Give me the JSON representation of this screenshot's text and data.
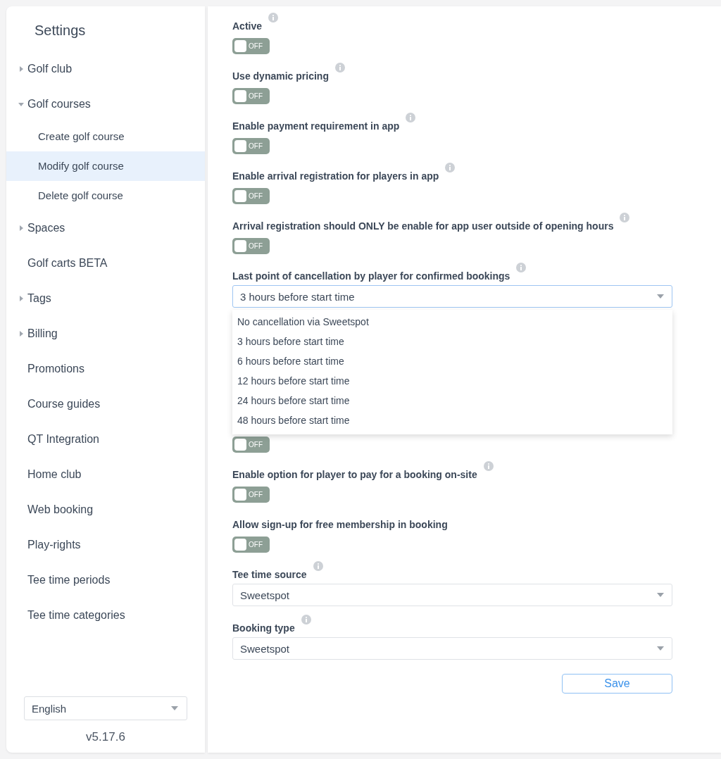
{
  "sidebar": {
    "title": "Settings",
    "items": [
      {
        "label": "Golf club",
        "expanded": false
      },
      {
        "label": "Golf courses",
        "expanded": true,
        "children": [
          {
            "label": "Create golf course",
            "selected": false
          },
          {
            "label": "Modify golf course",
            "selected": true
          },
          {
            "label": "Delete golf course",
            "selected": false
          }
        ]
      },
      {
        "label": "Spaces",
        "expanded": false
      },
      {
        "label": "Golf carts BETA"
      },
      {
        "label": "Tags",
        "expanded": false
      },
      {
        "label": "Billing",
        "expanded": false
      },
      {
        "label": "Promotions"
      },
      {
        "label": "Course guides"
      },
      {
        "label": "QT Integration"
      },
      {
        "label": "Home club"
      },
      {
        "label": "Web booking"
      },
      {
        "label": "Play-rights"
      },
      {
        "label": "Tee time periods"
      },
      {
        "label": "Tee time categories"
      }
    ],
    "language": "English",
    "version": "v5.17.6"
  },
  "form": {
    "fields": [
      {
        "kind": "toggle",
        "label": "Active",
        "info": true,
        "on": false,
        "state_text": "OFF"
      },
      {
        "kind": "toggle",
        "label": "Use dynamic pricing",
        "info": true,
        "on": false,
        "state_text": "OFF"
      },
      {
        "kind": "toggle",
        "label": "Enable payment requirement in app",
        "info": true,
        "on": false,
        "state_text": "OFF"
      },
      {
        "kind": "toggle",
        "label": "Enable arrival registration for players in app",
        "info": true,
        "on": false,
        "state_text": "OFF"
      },
      {
        "kind": "toggle",
        "label": "Arrival registration should ONLY be enable for app user outside of opening hours",
        "info": true,
        "on": false,
        "state_text": "OFF"
      },
      {
        "kind": "select",
        "label": "Last point of cancellation by player for confirmed bookings",
        "info": true,
        "value": "3 hours before start time",
        "open": true,
        "options": [
          "No cancellation via Sweetspot",
          "3 hours before start time",
          "6 hours before start time",
          "12 hours before start time",
          "24 hours before start time",
          "48 hours before start time"
        ]
      },
      {
        "kind": "toggle",
        "info": false,
        "on": false,
        "state_text": "OFF"
      },
      {
        "kind": "toggle",
        "label": "Enable option for player to pay for a booking on-site",
        "info": true,
        "on": false,
        "state_text": "OFF"
      },
      {
        "kind": "toggle",
        "label": "Allow sign-up for free membership in booking",
        "info": false,
        "on": false,
        "state_text": "OFF"
      },
      {
        "kind": "select",
        "label": "Tee time source",
        "info": true,
        "value": "Sweetspot",
        "open": false
      },
      {
        "kind": "select",
        "label": "Booking type",
        "info": true,
        "value": "Sweetspot",
        "open": false
      }
    ],
    "save": "Save"
  }
}
